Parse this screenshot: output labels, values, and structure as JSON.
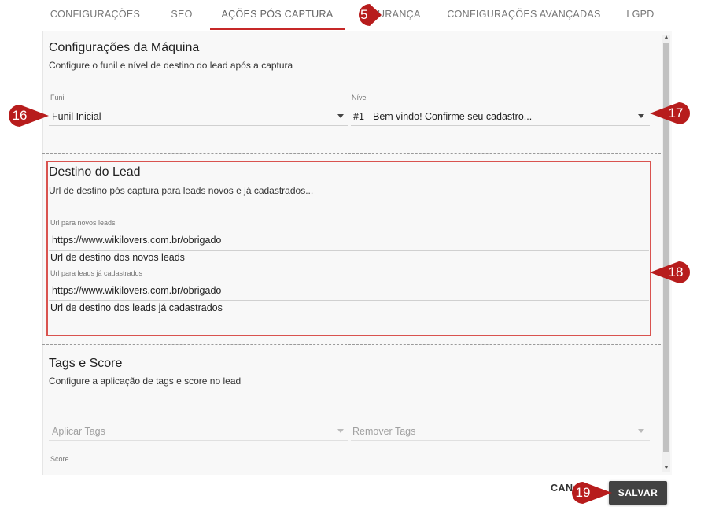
{
  "tabs": [
    {
      "label": "CONFIGURAÇÕES"
    },
    {
      "label": "SEO"
    },
    {
      "label": "AÇÕES PÓS CAPTURA"
    },
    {
      "label": "GURANÇA"
    },
    {
      "label": "CONFIGURAÇÕES AVANÇADAS"
    },
    {
      "label": "LGPD"
    }
  ],
  "machine": {
    "title": "Configurações da Máquina",
    "description": "Configure o funil e nível de destino do lead após a captura",
    "funnel_label": "Funil",
    "funnel_value": "Funil Inicial",
    "level_label": "Nível",
    "level_value": "#1 - Bem vindo! Confirme seu cadastro..."
  },
  "lead_destination": {
    "title": "Destino do Lead",
    "description": "Url de destino pós captura para leads novos e já cadastrados...",
    "new_label": "Url para novos leads",
    "new_value": "https://www.wikilovers.com.br/obrigado",
    "new_helper": "Url de destino dos novos leads",
    "existing_label": "Url para leads já cadastrados",
    "existing_value": "https://www.wikilovers.com.br/obrigado",
    "existing_helper": "Url de destino dos leads já cadastrados"
  },
  "tags_score": {
    "title": "Tags e Score",
    "description": "Configure a aplicação de tags e score no lead",
    "apply_placeholder": "Aplicar Tags",
    "remove_placeholder": "Remover Tags",
    "score_label": "Score"
  },
  "buttons": {
    "cancel": "CANCELAR",
    "save": "SALVAR"
  },
  "callouts": {
    "c15": "15",
    "c16": "16",
    "c17": "17",
    "c18": "18",
    "c19": "19"
  },
  "colors": {
    "accent": "#c62828",
    "callout": "#b71c1c",
    "highlight": "#d9534f",
    "save_button": "#424242"
  }
}
